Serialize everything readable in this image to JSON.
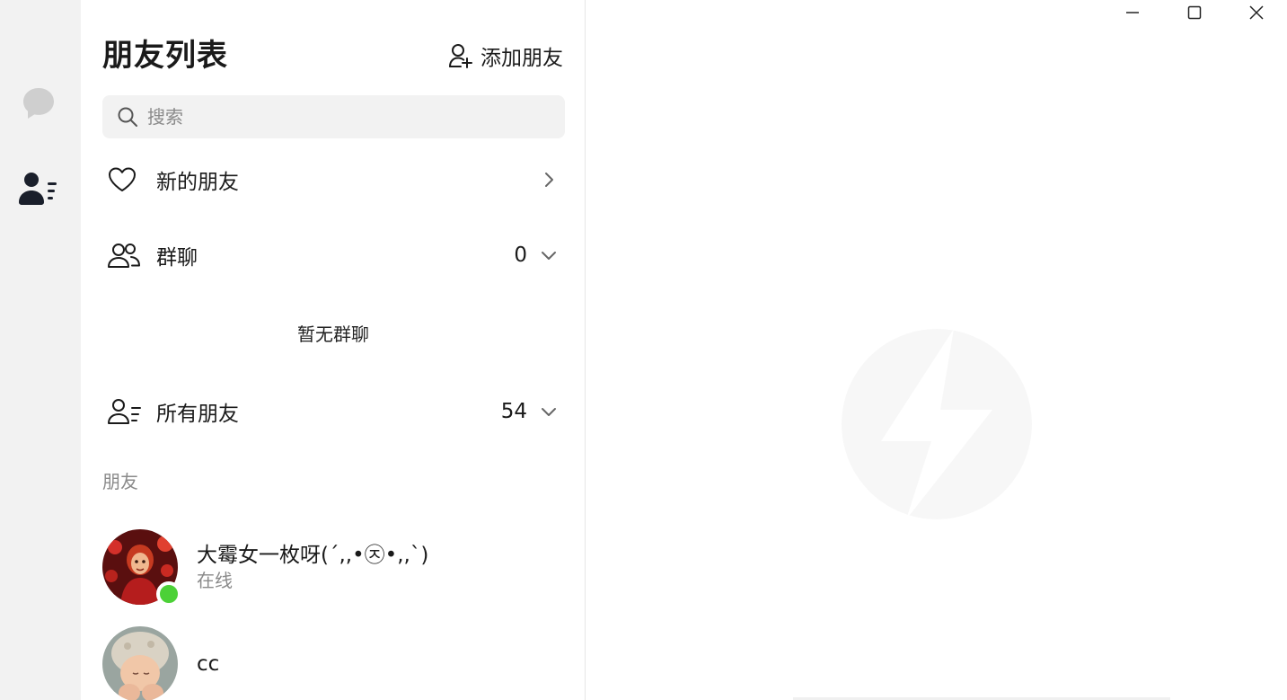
{
  "sidebar": {
    "items": [
      {
        "icon": "chat-bubble-icon",
        "active": false
      },
      {
        "icon": "contacts-icon",
        "active": true
      }
    ]
  },
  "header": {
    "title": "朋友列表",
    "add_friend_label": "添加朋友"
  },
  "search": {
    "placeholder": "搜索",
    "value": ""
  },
  "rows": {
    "new_friends": {
      "label": "新的朋友"
    },
    "groups": {
      "label": "群聊",
      "count": "0",
      "empty_text": "暂无群聊"
    },
    "all_friends": {
      "label": "所有朋友",
      "count": "54"
    }
  },
  "friends_section_label": "朋友",
  "friends": [
    {
      "name": "大霉女一枚呀(´,,•㉨•,,`)",
      "status": "在线",
      "online": true
    },
    {
      "name": "cc",
      "status": "",
      "online": false
    }
  ],
  "colors": {
    "rail_bg": "#f2f2f2",
    "online": "#4cd137",
    "muted_text": "#8a8a8a"
  }
}
